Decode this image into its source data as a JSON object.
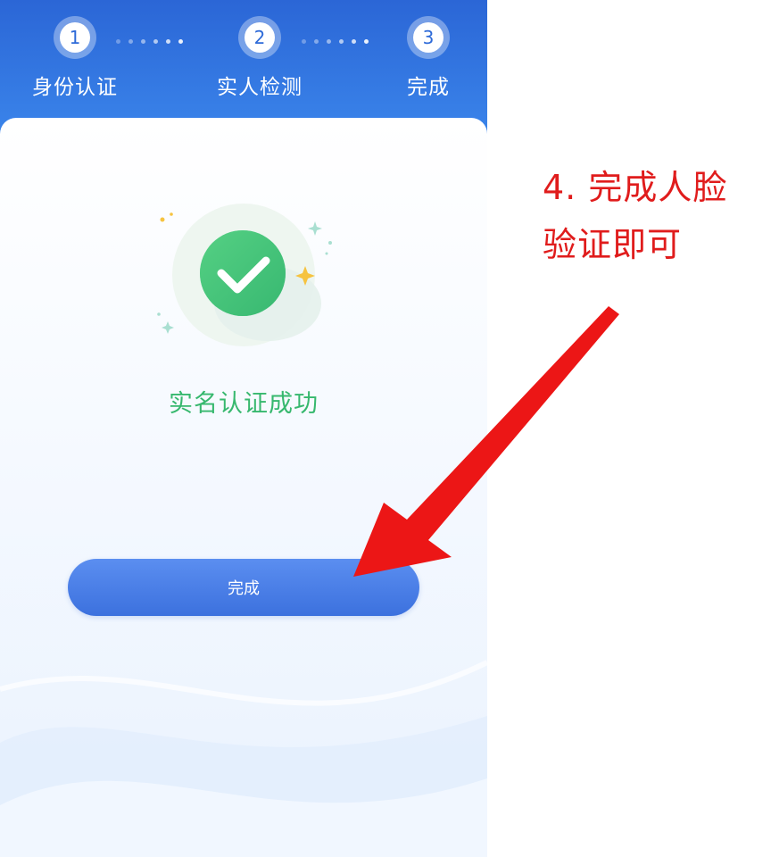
{
  "steps": [
    {
      "number": "1",
      "label": "身份认证"
    },
    {
      "number": "2",
      "label": "实人检测"
    },
    {
      "number": "3",
      "label": "完成"
    }
  ],
  "result": {
    "message": "实名认证成功",
    "icon": "check-circle-icon"
  },
  "done_button": {
    "label": "完成"
  },
  "annotation": {
    "line1": "4. 完成人脸",
    "line2": "验证即可"
  },
  "colors": {
    "header_blue": "#2f6fd9",
    "success_green": "#37b86e",
    "button_blue": "#4a80e8",
    "annotation_red": "#e01c1c"
  }
}
